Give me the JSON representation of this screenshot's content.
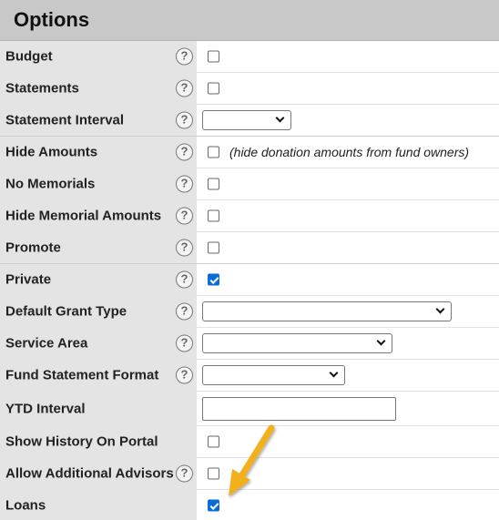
{
  "header": {
    "title": "Options"
  },
  "help_glyph": "?",
  "rows": [
    {
      "label": "Budget",
      "control": "checkbox",
      "checked": false
    },
    {
      "label": "Statements",
      "control": "checkbox",
      "checked": false
    },
    {
      "label": "Statement Interval",
      "control": "select",
      "value": ""
    },
    {
      "label": "Hide Amounts",
      "control": "checkbox",
      "checked": false,
      "note": "(hide donation amounts from fund owners)"
    },
    {
      "label": "No Memorials",
      "control": "checkbox",
      "checked": false
    },
    {
      "label": "Hide Memorial Amounts",
      "control": "checkbox",
      "checked": false
    },
    {
      "label": "Promote",
      "control": "checkbox",
      "checked": false
    },
    {
      "label": "Private",
      "control": "checkbox",
      "checked": true
    },
    {
      "label": "Default Grant Type",
      "control": "select",
      "value": ""
    },
    {
      "label": "Service Area",
      "control": "select",
      "value": ""
    },
    {
      "label": "Fund Statement Format",
      "control": "select",
      "value": ""
    },
    {
      "label": "YTD Interval",
      "control": "text",
      "value": ""
    },
    {
      "label": "Show History On Portal",
      "control": "checkbox",
      "checked": false
    },
    {
      "label": "Allow Additional Advisors",
      "control": "checkbox",
      "checked": false
    },
    {
      "label": "Loans",
      "control": "checkbox",
      "checked": true
    }
  ],
  "colors": {
    "accent_check": "#0a6cdc",
    "annotation_arrow": "#f2b01e"
  }
}
